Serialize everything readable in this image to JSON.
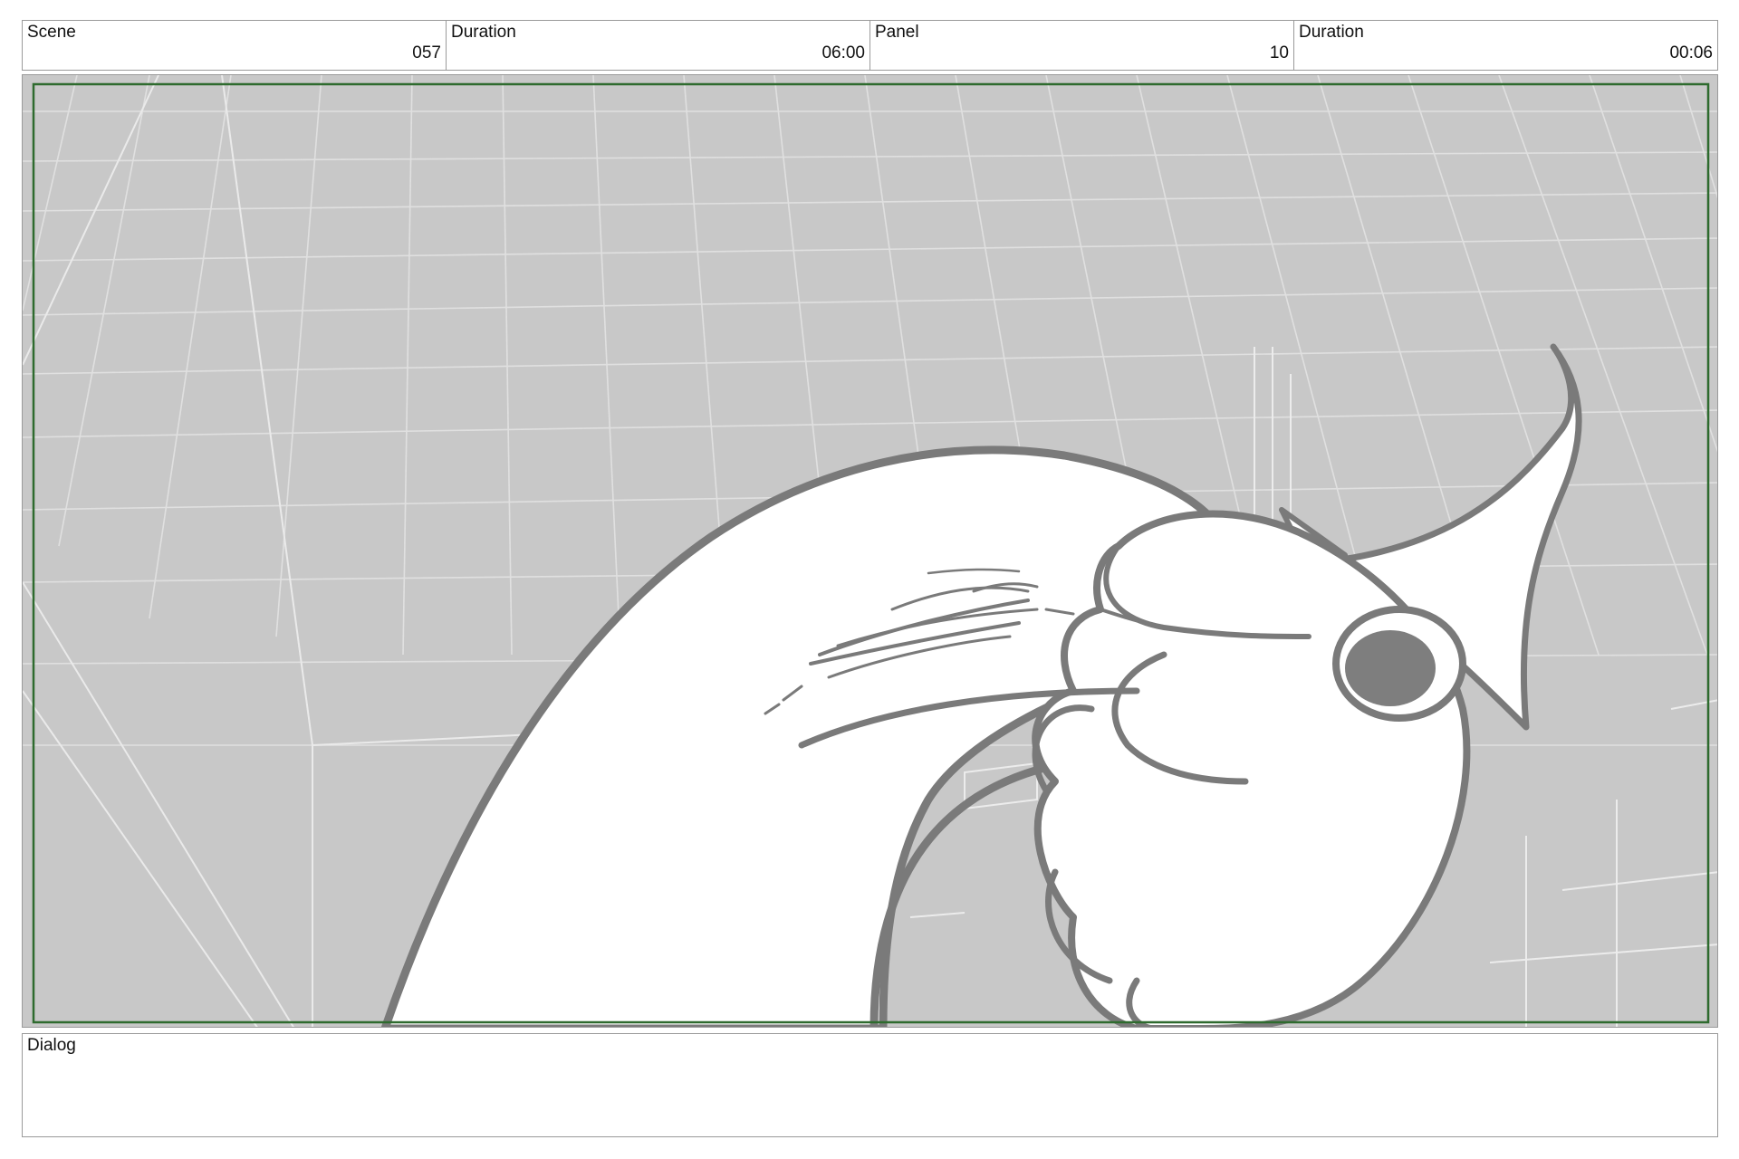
{
  "header": {
    "scene_label": "Scene",
    "scene_value": "057",
    "scene_duration_label": "Duration",
    "scene_duration_value": "06:00",
    "panel_label": "Panel",
    "panel_value": "10",
    "panel_duration_label": "Duration",
    "panel_duration_value": "00:06"
  },
  "panel": {
    "background_color": "#c8c8c8",
    "grid_line_color": "#e6e6e6",
    "safe_frame_color": "#2e6b2e",
    "character_line_color": "#7a7a7a",
    "character_fill_color": "#ffffff",
    "icons": [
      "perspective-grid-background",
      "fish-character-drawing",
      "safe-frame"
    ]
  },
  "dialog": {
    "label": "Dialog",
    "text": ""
  }
}
